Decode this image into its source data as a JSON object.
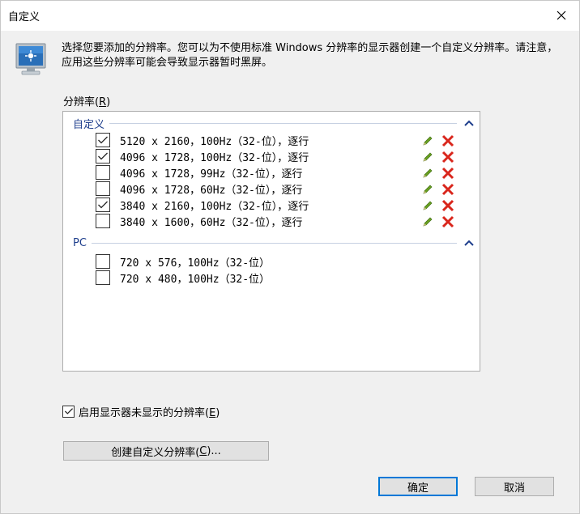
{
  "window": {
    "title": "自定义"
  },
  "intro_text": "选择您要添加的分辨率。您可以为不使用标准 Windows 分辨率的显示器创建一个自定义分辨率。请注意，应用这些分辨率可能会导致显示器暂时黑屏。",
  "resolution_list": {
    "label_main": "分辨率(",
    "label_key": "R",
    "label_end": ")",
    "groups": [
      {
        "name": "自定义",
        "items": [
          {
            "label": "5120 x 2160，100Hz（32-位），逐行",
            "checked": true
          },
          {
            "label": "4096 x 1728，100Hz（32-位），逐行",
            "checked": true
          },
          {
            "label": "4096 x 1728，99Hz（32-位），逐行",
            "checked": false
          },
          {
            "label": "4096 x 1728，60Hz（32-位），逐行",
            "checked": false
          },
          {
            "label": "3840 x 2160，100Hz（32-位），逐行",
            "checked": true
          },
          {
            "label": "3840 x 1600，60Hz（32-位），逐行",
            "checked": false
          }
        ]
      },
      {
        "name": "PC",
        "items": [
          {
            "label": "720 x 576，100Hz（32-位）",
            "checked": false
          },
          {
            "label": "720 x 480，100Hz（32-位）",
            "checked": false
          }
        ]
      }
    ]
  },
  "enable_option": {
    "label_main": "启用显示器未显示的分辨率(",
    "label_key": "E",
    "label_end": ")",
    "checked": true
  },
  "buttons": {
    "create_main": "创建自定义分辨率(",
    "create_key": "C",
    "create_end": ")...",
    "ok": "确定",
    "cancel": "取消"
  },
  "colors": {
    "accent": "#0078d7",
    "group_header": "#1e3e8c",
    "edit_icon": "#6aa121",
    "delete_icon": "#d9261c"
  },
  "icons": {
    "close": "close-icon",
    "monitor": "monitor-icon",
    "edit": "pencil-icon",
    "delete": "delete-x-icon",
    "collapse": "chevron-up-icon"
  }
}
